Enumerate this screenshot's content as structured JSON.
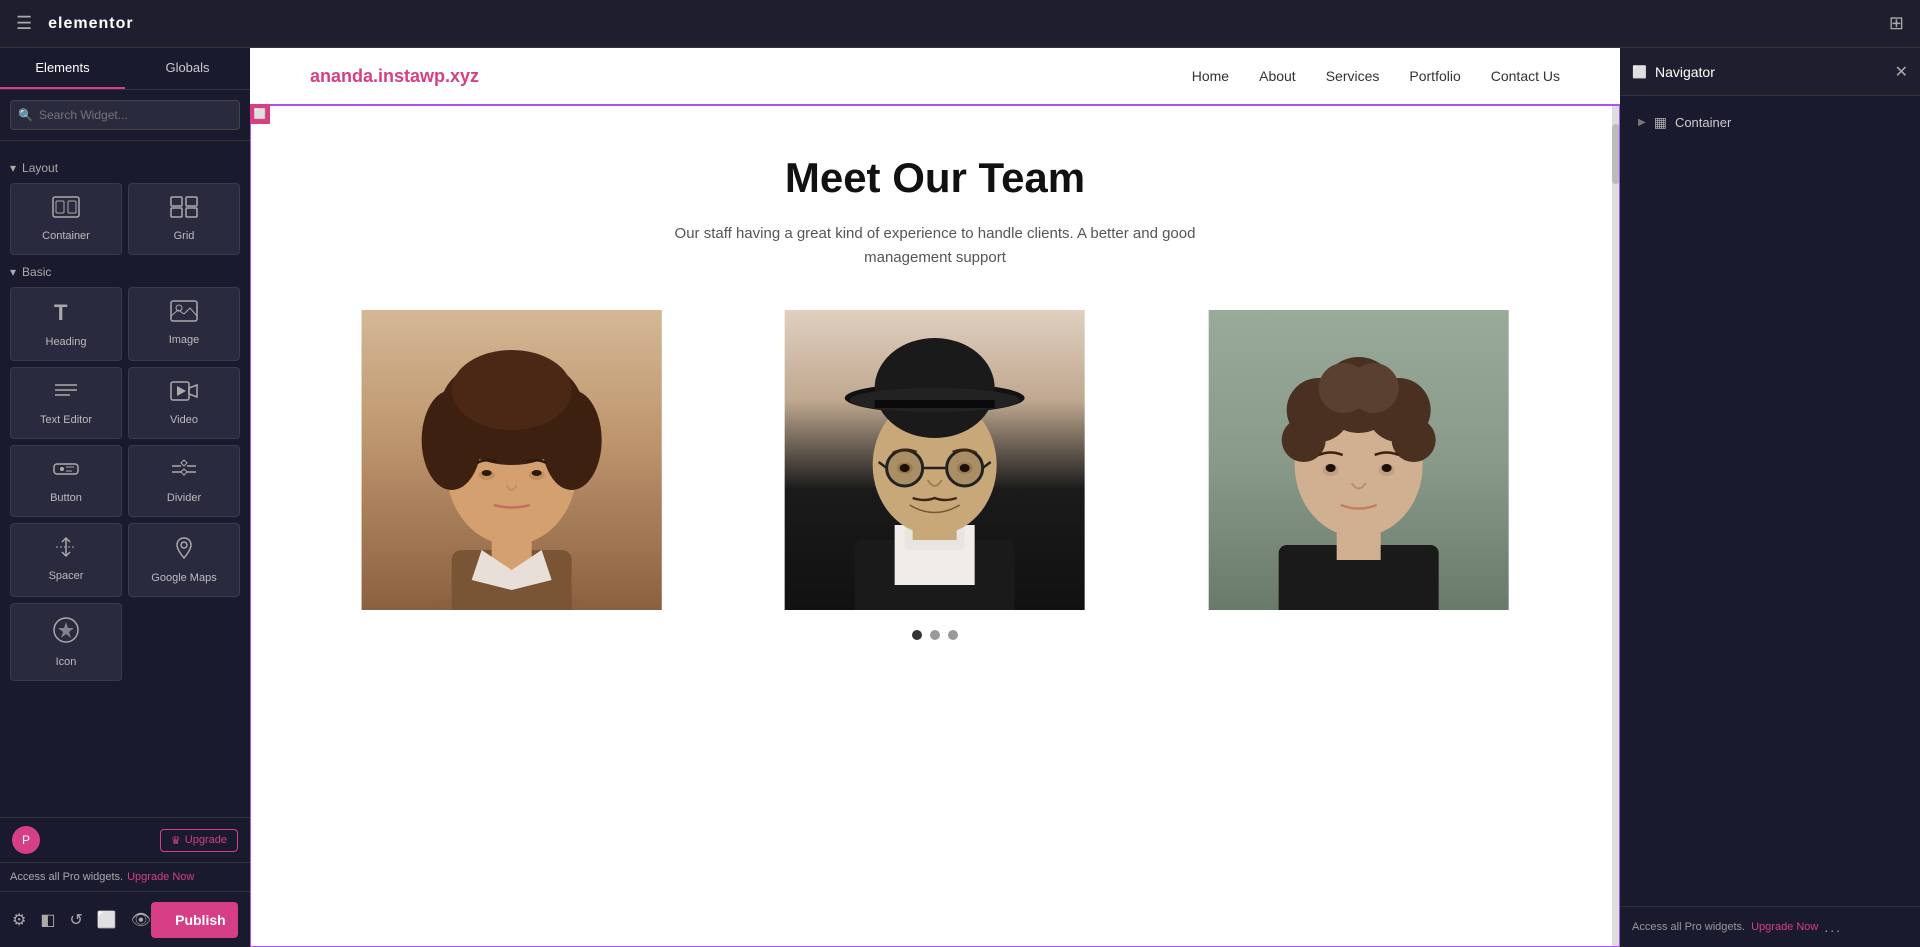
{
  "topbar": {
    "logo": "elementor",
    "hamburger_label": "☰",
    "grid_label": "⊞"
  },
  "left_panel": {
    "tabs": [
      {
        "id": "elements",
        "label": "Elements",
        "active": true
      },
      {
        "id": "globals",
        "label": "Globals",
        "active": false
      }
    ],
    "search_placeholder": "Search Widget...",
    "sections": [
      {
        "id": "layout",
        "label": "Layout",
        "widgets": [
          {
            "id": "container",
            "label": "Container",
            "icon": "▦"
          },
          {
            "id": "grid",
            "label": "Grid",
            "icon": "⊞"
          }
        ]
      },
      {
        "id": "basic",
        "label": "Basic",
        "widgets": [
          {
            "id": "heading",
            "label": "Heading",
            "icon": "T"
          },
          {
            "id": "image",
            "label": "Image",
            "icon": "🖼"
          },
          {
            "id": "text-editor",
            "label": "Text Editor",
            "icon": "≡"
          },
          {
            "id": "video",
            "label": "Video",
            "icon": "▶"
          },
          {
            "id": "button",
            "label": "Button",
            "icon": "⬜"
          },
          {
            "id": "divider",
            "label": "Divider",
            "icon": "÷"
          },
          {
            "id": "spacer",
            "label": "Spacer",
            "icon": "↕"
          },
          {
            "id": "google-maps",
            "label": "Google Maps",
            "icon": "📍"
          },
          {
            "id": "icon",
            "label": "Icon",
            "icon": "★"
          }
        ]
      }
    ],
    "upgrade": {
      "crown_icon": "♛",
      "label": "Upgrade",
      "user_icon": "P",
      "access_text": "Access all Pro widgets.",
      "upgrade_link": "Upgrade Now"
    }
  },
  "bottom_bar": {
    "icons": [
      {
        "id": "settings",
        "symbol": "⚙"
      },
      {
        "id": "layers",
        "symbol": "◧"
      },
      {
        "id": "undo",
        "symbol": "↺"
      },
      {
        "id": "responsive",
        "symbol": "⬜"
      },
      {
        "id": "preview",
        "symbol": "👁"
      }
    ],
    "publish_label": "Publish",
    "chevron_label": "▲"
  },
  "website": {
    "logo": "ananda.instawp.xyz",
    "nav_links": [
      {
        "id": "home",
        "label": "Home"
      },
      {
        "id": "about",
        "label": "About"
      },
      {
        "id": "services",
        "label": "Services"
      },
      {
        "id": "portfolio",
        "label": "Portfolio"
      },
      {
        "id": "contact",
        "label": "Contact Us"
      }
    ],
    "section": {
      "title": "Meet Our Team",
      "subtitle": "Our staff having a great kind of experience to handle clients. A better and good management support",
      "team_members": [
        {
          "id": "member1",
          "bg_color": "#c8a878",
          "hair_color": "#4a3020",
          "skin_color": "#d4a070"
        },
        {
          "id": "member2",
          "bg_color": "#d0c0b0",
          "hat_color": "#1a1a1a",
          "skin_color": "#c0a080"
        },
        {
          "id": "member3",
          "bg_color": "#8a9a8a",
          "hair_color": "#5a4030",
          "skin_color": "#d0b090"
        }
      ],
      "dots": [
        {
          "active": true
        },
        {
          "active": false
        },
        {
          "active": false
        }
      ]
    }
  },
  "navigator": {
    "title": "Navigator",
    "close_icon": "✕",
    "items": [
      {
        "id": "container",
        "label": "Container",
        "icon": "▦",
        "arrow": "▶"
      }
    ],
    "footer": {
      "access_text": "Access all Pro widgets.",
      "upgrade_link": "Upgrade Now",
      "dots": "..."
    }
  }
}
